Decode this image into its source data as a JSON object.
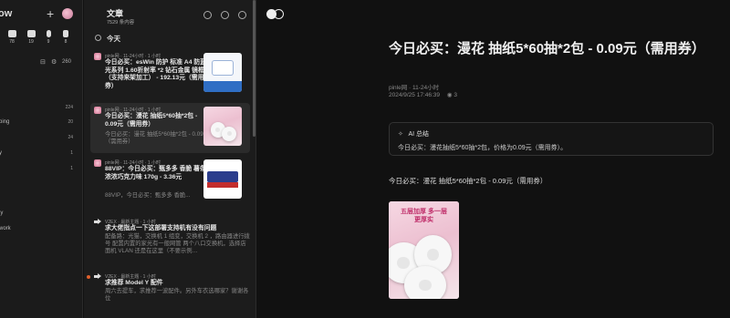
{
  "sidebar": {
    "title": "ow",
    "stats": [
      {
        "icon": "clipboard-icon",
        "count": "78"
      },
      {
        "icon": "video-icon",
        "count": "19"
      },
      {
        "icon": "mic-icon",
        "count": "9"
      },
      {
        "icon": "bookmark-icon",
        "count": "8"
      }
    ],
    "unread_count": "260",
    "items": [
      {
        "label": "",
        "count": "224"
      },
      {
        "label": "ping",
        "count": "20"
      },
      {
        "label": "",
        "count": "24"
      },
      {
        "label": "y",
        "count": "1"
      },
      {
        "label": "",
        "count": "1"
      },
      {
        "label": "",
        "count": ""
      },
      {
        "label": "ly",
        "count": ""
      },
      {
        "label": "work",
        "count": ""
      }
    ]
  },
  "list": {
    "title": "文章",
    "subtitle": "7529 条内容",
    "today_label": "今天",
    "cards": [
      {
        "source": "pinle网 · 11-24小时 · 1 小时",
        "title": "今日必买：esWin 防护 标准 A4 防蓝光系列 1.60折射率 *2 钻石金属 镜框（支持来架加工） - 192.13元（需用券）",
        "excerpt": "",
        "thumb": "blue"
      },
      {
        "source": "pinle网 · 11-24小时 · 1 小时",
        "title": "今日必买：漫花 抽纸5*60抽*2包 - 0.09元（需用券）",
        "excerpt": "今日必买：漫花 抽纸5*60抽*2包 - 0.09元（需用券）",
        "thumb": "pink"
      },
      {
        "source": "pinle网 · 11-24小时 · 1 小时",
        "title": "88VIP：今日必买：甄多多 香脆 薯条 浓浓巧克力味 170g - 3.36元",
        "excerpt": "88VIP，今日必买：甄多多 香脆...",
        "thumb": "choc"
      },
      {
        "source": "V2EX · 最新主题 · 1 小时",
        "title": "求大佬指点一下这部署支持机有没有问题",
        "excerpt": "配备路：光猫，交换机 1 组变，交换机 2 ，路由器进行拨号 配置内置的家光有一般网管 两个八口交换机，选择店面机 VLAN 还是在这里（不要示例…",
        "thumb": ""
      },
      {
        "source": "V2EX · 最新主题 · 1 小时",
        "title": "求推荐 Model Y 配件",
        "excerpt": "周六去提车，求推荐一波配件。另外车衣选哪家？谢谢各位",
        "thumb": ""
      }
    ]
  },
  "reader": {
    "title": "今日必买：漫花 抽纸5*60抽*2包 - 0.09元（需用券）",
    "source": "pinle网 · 11-24小时",
    "datetime": "2024/9/25 17:46:39",
    "views": "3",
    "ai_heading": "AI 总结",
    "ai_summary": "今日必买：漫花抽纸5*60抽*2包，价格为0.09元（需用券）。",
    "body_text": "今日必买：漫花 抽纸5*60抽*2包 - 0.09元（需用券）",
    "image_banner": "五层加厚 多一层更厚实"
  }
}
